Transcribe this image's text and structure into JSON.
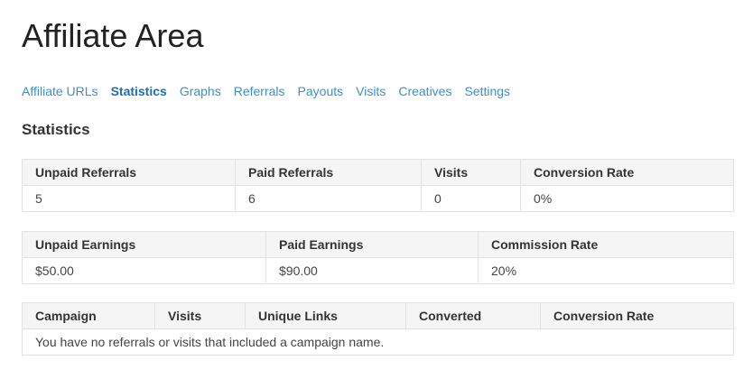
{
  "page": {
    "title": "Affiliate Area"
  },
  "tabs": [
    {
      "label": "Affiliate URLs",
      "active": false
    },
    {
      "label": "Statistics",
      "active": true
    },
    {
      "label": "Graphs",
      "active": false
    },
    {
      "label": "Referrals",
      "active": false
    },
    {
      "label": "Payouts",
      "active": false
    },
    {
      "label": "Visits",
      "active": false
    },
    {
      "label": "Creatives",
      "active": false
    },
    {
      "label": "Settings",
      "active": false
    }
  ],
  "statistics": {
    "heading": "Statistics",
    "referrals_table": {
      "headers": [
        "Unpaid Referrals",
        "Paid Referrals",
        "Visits",
        "Conversion Rate"
      ],
      "row": [
        "5",
        "6",
        "0",
        "0%"
      ]
    },
    "earnings_table": {
      "headers": [
        "Unpaid Earnings",
        "Paid Earnings",
        "Commission Rate"
      ],
      "row": [
        "$50.00",
        "$90.00",
        "20%"
      ]
    },
    "campaign_table": {
      "headers": [
        "Campaign",
        "Visits",
        "Unique Links",
        "Converted",
        "Conversion Rate"
      ],
      "empty_message": "You have no referrals or visits that included a campaign name."
    }
  },
  "colors": {
    "link": "#3a8fd0",
    "active_link": "#1f6fae",
    "header_bg": "#f5f5f5",
    "border": "#e2e2e2"
  }
}
